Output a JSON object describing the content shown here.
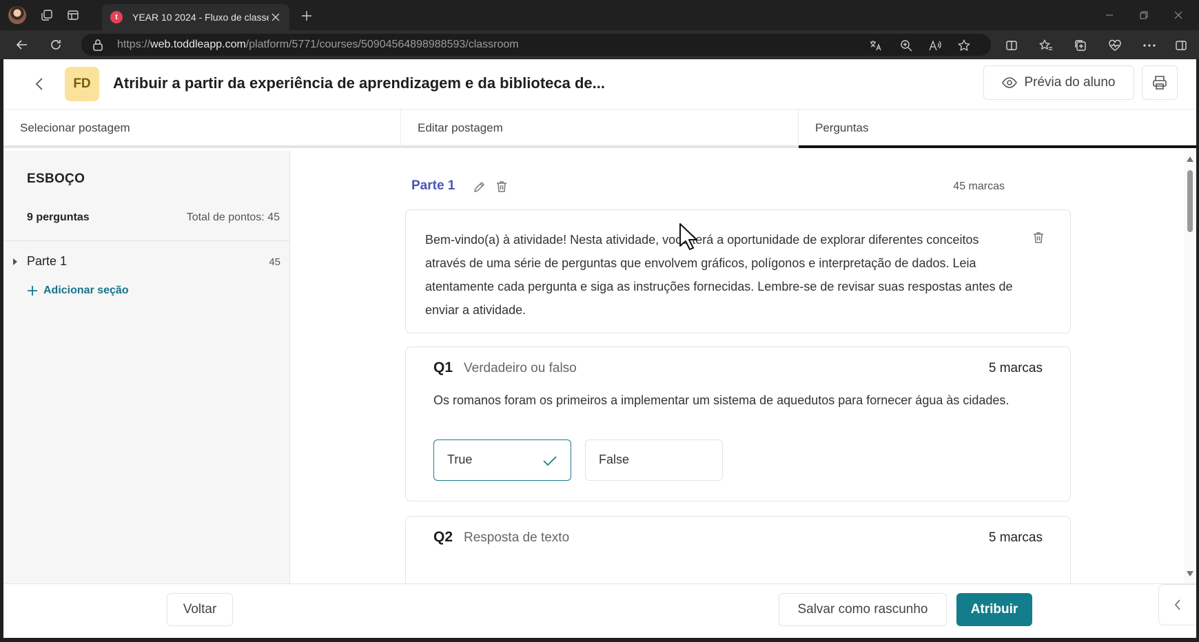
{
  "browser": {
    "tab_title": "YEAR 10 2024 - Fluxo de classe",
    "tab_favicon_letter": "t",
    "url_prefix": "https://",
    "url_host": "web.toddleapp.com",
    "url_path": "/platform/5771/courses/50904564898988593/classroom"
  },
  "header": {
    "avatar_initials": "FD",
    "title": "Atribuir a partir da experiência de aprendizagem e da biblioteca de...",
    "preview_label": "Prévia do aluno"
  },
  "steps": [
    {
      "label": "Selecionar postagem"
    },
    {
      "label": "Editar postagem"
    },
    {
      "label": "Perguntas"
    }
  ],
  "sidebar": {
    "title": "ESBOÇO",
    "question_count": "9 perguntas",
    "total_points": "Total de pontos: 45",
    "items": [
      {
        "label": "Parte 1",
        "points": "45"
      }
    ],
    "add_section": "Adicionar seção"
  },
  "part": {
    "label": "Parte 1",
    "marks": "45 marcas",
    "intro": "Bem-vindo(a) à atividade! Nesta atividade, você terá a oportunidade de explorar diferentes conceitos através de uma série de perguntas que envolvem gráficos, polígonos e interpretação de dados. Leia atentamente cada pergunta e siga as instruções fornecidas. Lembre-se de revisar suas respostas antes de enviar a atividade."
  },
  "questions": [
    {
      "num": "Q1",
      "type": "Verdadeiro ou falso",
      "marks": "5 marcas",
      "text": "Os romanos foram os primeiros a implementar um sistema de aquedutos para fornecer água às cidades.",
      "options": [
        "True",
        "False"
      ],
      "selected": "True"
    },
    {
      "num": "Q2",
      "type": "Resposta de texto",
      "marks": "5 marcas"
    }
  ],
  "footer": {
    "back_label": "Voltar",
    "draft_label": "Salvar como rascunho",
    "assign_label": "Atribuir"
  },
  "colors": {
    "accent": "#137d8b",
    "part_label": "#4a54b4",
    "avatar_bg": "#fbe29a"
  }
}
